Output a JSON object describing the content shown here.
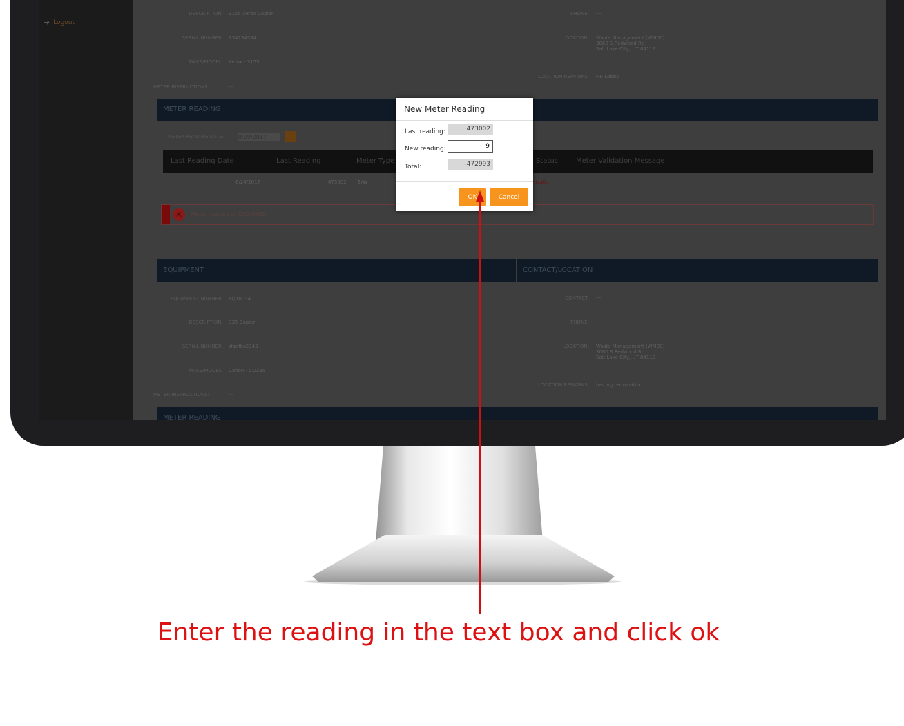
{
  "sidebar": {
    "logout_label": "Logout"
  },
  "top_section": {
    "fields_left": [
      {
        "label": "DESCRIPTION:",
        "value": "3155 Xerox Copier"
      },
      {
        "label": "SERIAL NUMBER:",
        "value": "234234534"
      },
      {
        "label": "MAKE/MODEL:",
        "value": "Xerox - 3155"
      },
      {
        "label": "METER INSTRUCTIONS:",
        "value": "---"
      }
    ],
    "fields_right": [
      {
        "label": "PHONE:",
        "value": "---"
      },
      {
        "label": "LOCATION:",
        "value": "Waste Management (WM00)\n3060 S Redwood Rd\nSalt Lake City, UT 84119"
      },
      {
        "label": "LOCATION REMARKS:",
        "value": "HR Lobby"
      }
    ]
  },
  "meter_reading_section": {
    "title": "METER READING",
    "date_label": "METER READING DATE:",
    "date_value": "8/29/2017",
    "table_headers": [
      "Last Reading Date",
      "Last Reading",
      "Meter Type",
      "Status",
      "Meter Validation Message"
    ],
    "row": {
      "last_reading_date": "6/24/2017",
      "last_reading": "473002",
      "meter_type": "B/W",
      "status": "Invalid"
    },
    "error_message": "Meter reading is REQUIRED"
  },
  "equipment_section": {
    "title": "EQUIPMENT",
    "fields": [
      {
        "label": "EQUIPMENT NUMBER:",
        "value": "EQ10034"
      },
      {
        "label": "DESCRIPTION:",
        "value": "335 Copier"
      },
      {
        "label": "SERIAL NUMBER:",
        "value": "sfsdfbs2343"
      },
      {
        "label": "MAKE/MODEL:",
        "value": "Canon - CO335"
      },
      {
        "label": "METER INSTRUCTIONS:",
        "value": "---"
      }
    ]
  },
  "contact_section": {
    "title": "CONTACT/LOCATION",
    "fields": [
      {
        "label": "CONTACT:",
        "value": "---"
      },
      {
        "label": "PHONE:",
        "value": "---"
      },
      {
        "label": "LOCATION:",
        "value": "Waste Management (WM00)\n3060 S Redwood Rd\nSalt Lake City, UT 84119"
      },
      {
        "label": "LOCATION REMARKS:",
        "value": "testing termination"
      }
    ]
  },
  "bottom_section_title": "METER READING",
  "dialog": {
    "title": "New Meter Reading",
    "last_reading_label": "Last reading:",
    "last_reading_value": "473002",
    "new_reading_label": "New reading:",
    "new_reading_value": "9",
    "total_label": "Total:",
    "total_value": "-472993",
    "ok_label": "OK",
    "cancel_label": "Cancel"
  },
  "caption": "Enter the reading in the text box and click ok",
  "colors": {
    "accent": "#f7941d",
    "annotation": "#dd1111",
    "section_bar": "#0f1a26"
  }
}
